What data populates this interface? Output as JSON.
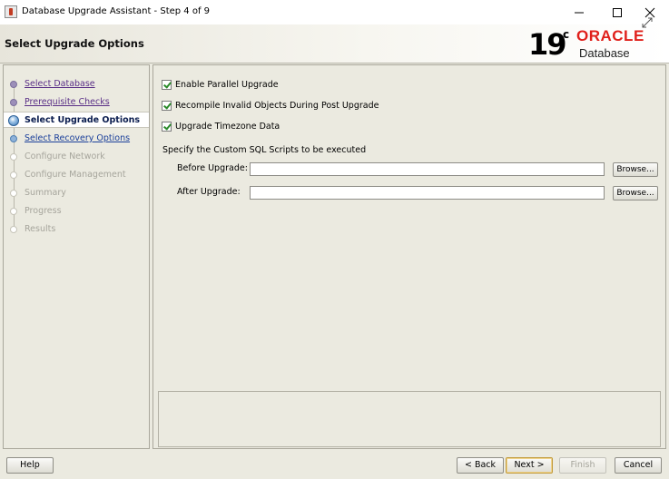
{
  "window": {
    "title": "Database Upgrade Assistant - Step 4 of 9",
    "controls": {
      "minimize_icon": "minimize-icon",
      "maximize_icon": "maximize-icon",
      "close_icon": "close-icon"
    }
  },
  "header": {
    "title": "Select Upgrade Options",
    "logo": {
      "version": "19",
      "superscript": "c",
      "brand": "ORACLE",
      "product": "Database"
    }
  },
  "nav": {
    "items": [
      {
        "label": "Select Database",
        "state": "visited"
      },
      {
        "label": "Prerequisite Checks",
        "state": "visited"
      },
      {
        "label": "Select Upgrade Options",
        "state": "current"
      },
      {
        "label": "Select Recovery Options",
        "state": "link"
      },
      {
        "label": "Configure Network",
        "state": "disabled"
      },
      {
        "label": "Configure Management",
        "state": "disabled"
      },
      {
        "label": "Summary",
        "state": "disabled"
      },
      {
        "label": "Progress",
        "state": "disabled"
      },
      {
        "label": "Results",
        "state": "disabled"
      }
    ]
  },
  "options": {
    "parallel_upgrade": {
      "label": "Enable Parallel Upgrade",
      "checked": true
    },
    "recompile": {
      "label": "Recompile Invalid Objects During Post Upgrade",
      "checked": true
    },
    "timezone": {
      "label": "Upgrade Timezone Data",
      "checked": true
    }
  },
  "scripts": {
    "section_label": "Specify the Custom SQL Scripts to be executed",
    "before": {
      "label": "Before Upgrade:",
      "value": "",
      "browse": "Browse..."
    },
    "after": {
      "label": "After Upgrade:",
      "value": "",
      "browse": "Browse..."
    }
  },
  "footer": {
    "help": "Help",
    "back": "< Back",
    "next": "Next >",
    "finish": "Finish",
    "cancel": "Cancel"
  },
  "colors": {
    "background": "#ebeae0",
    "oracle_red": "#e0201b",
    "visited_link": "#5a2f87",
    "current_step": "#0b1d4f"
  }
}
